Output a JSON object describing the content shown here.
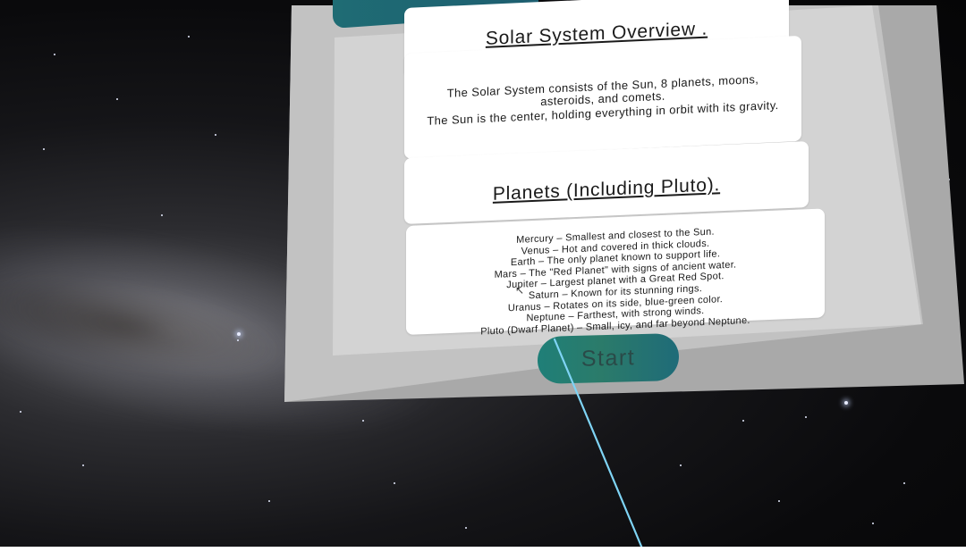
{
  "section1": {
    "title": "Solar System Overview .",
    "description_lines": [
      "The Solar System consists of the Sun, 8 planets, moons,",
      "asteroids, and comets.",
      "The Sun is the center, holding everything in orbit with its gravity."
    ]
  },
  "section2": {
    "title": "Planets (Including Pluto).",
    "planet_lines": [
      "Mercury – Smallest and closest to the Sun.",
      "Venus – Hot and covered in thick clouds.",
      "Earth – The only planet known to support life.",
      "Mars – The \"Red Planet\" with signs of ancient water.",
      "Jupiter – Largest planet with a Great Red Spot.",
      "Saturn – Known for its stunning rings.",
      "Uranus – Rotates on its side, blue-green color.",
      "Neptune – Farthest, with strong winds.",
      "Pluto (Dwarf Planet) – Small, icy, and far beyond Neptune."
    ]
  },
  "start_button": {
    "label": "Start"
  },
  "colors": {
    "button_gradient_start": "#1f7f78",
    "button_gradient_end": "#1f6b78",
    "panel_grey": "#c9c9c9",
    "card_white": "#ffffff",
    "laser": "#4fc3f7"
  },
  "icons": {
    "pointer": "cursor-icon"
  }
}
